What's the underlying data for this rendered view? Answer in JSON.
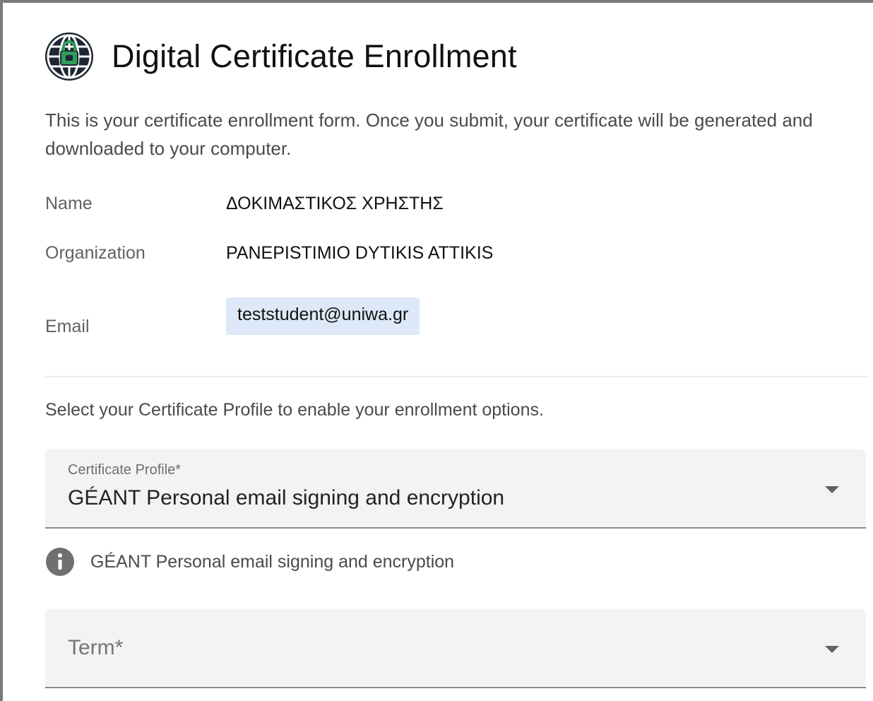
{
  "header": {
    "title": "Digital Certificate Enrollment",
    "logo_icon": "globe-lock-icon"
  },
  "intro": {
    "text": "This is your certificate enrollment form. Once you submit, your certificate will be generated and downloaded to your computer."
  },
  "details": {
    "name_label": "Name",
    "name_value": "ΔΟΚΙΜΑΣΤΙΚΟΣ ΧΡΗΣΤΗΣ",
    "organization_label": "Organization",
    "organization_value": "PANEPISTIMIO DYTIKIS ATTIKIS",
    "email_label": "Email",
    "email_value": "teststudent@uniwa.gr"
  },
  "profile_section": {
    "hint": "Select your Certificate Profile to enable your enrollment options.",
    "profile_label": "Certificate Profile*",
    "profile_value": "GÉANT Personal email signing and encryption",
    "info_icon": "info-icon",
    "info_text": "GÉANT Personal email signing and encryption",
    "term_placeholder": "Term*"
  },
  "colors": {
    "accent_logo": "#2e9e5b",
    "email_chip_bg": "#dde9f8",
    "field_bg": "#f3f3f3"
  }
}
